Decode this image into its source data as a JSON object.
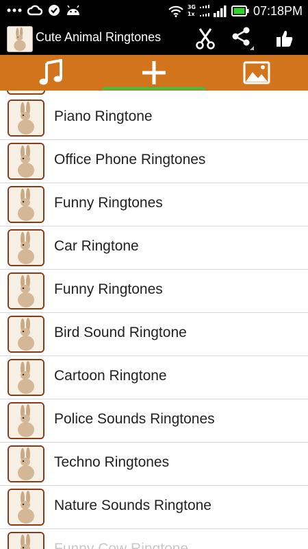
{
  "status_bar": {
    "time": "07:18PM",
    "network_labels": [
      "3G",
      "1x"
    ],
    "icons": [
      "more-icon",
      "cloud-icon",
      "check-icon",
      "android-icon",
      "wifi-icon",
      "signal-icon",
      "battery-icon"
    ]
  },
  "action_bar": {
    "title": "Cute Animal Ringtones",
    "actions": [
      "scissors-icon",
      "share-icon",
      "thumbs-up-icon"
    ]
  },
  "tabs": [
    {
      "icon": "music-note-icon",
      "selected": false
    },
    {
      "icon": "plus-icon",
      "selected": true
    },
    {
      "icon": "image-icon",
      "selected": false
    }
  ],
  "colors": {
    "tab_bar": "#d2741c",
    "tab_indicator": "#3fbf3f",
    "action_bar": "#000000",
    "thumb_border": "#8b3a17"
  },
  "list": {
    "items": [
      {
        "label": "Piano Ringtone"
      },
      {
        "label": "Office Phone Ringtones"
      },
      {
        "label": "Funny Ringtones"
      },
      {
        "label": "Car Ringtone"
      },
      {
        "label": "Funny Ringtones"
      },
      {
        "label": "Bird Sound Ringtone"
      },
      {
        "label": "Cartoon Ringtone"
      },
      {
        "label": "Police Sounds Ringtones"
      },
      {
        "label": "Techno Ringtones"
      },
      {
        "label": "Nature Sounds Ringtone"
      },
      {
        "label": "Funny Cow Ringtone"
      }
    ]
  }
}
